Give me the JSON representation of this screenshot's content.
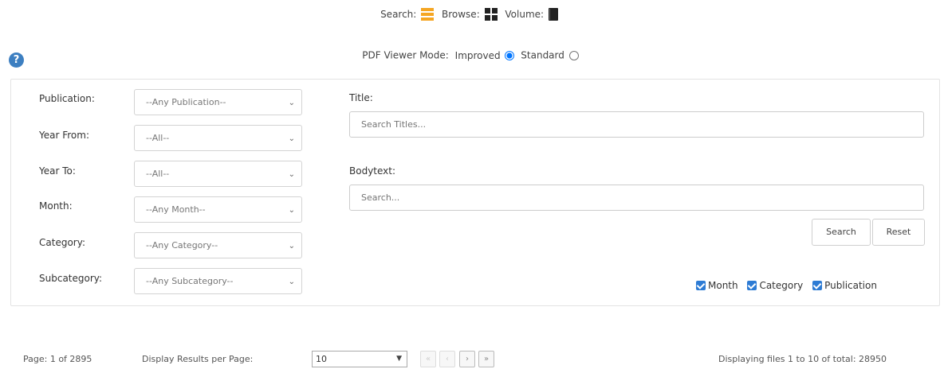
{
  "modebar": {
    "search_label": "Search:",
    "browse_label": "Browse:",
    "volume_label": "Volume:"
  },
  "viewer_mode": {
    "label": "PDF Viewer Mode:",
    "improved_label": "Improved",
    "standard_label": "Standard",
    "selected": "Improved"
  },
  "help_icon": "?",
  "filters": {
    "publication": {
      "label": "Publication:",
      "value": "--Any Publication--"
    },
    "year_from": {
      "label": "Year From:",
      "value": "--All--"
    },
    "year_to": {
      "label": "Year To:",
      "value": "--All--"
    },
    "month": {
      "label": "Month:",
      "value": "--Any Month--"
    },
    "category": {
      "label": "Category:",
      "value": "--Any Category--"
    },
    "subcategory": {
      "label": "Subcategory:",
      "value": "--Any Subcategory--"
    }
  },
  "title_field": {
    "label": "Title:",
    "placeholder": "Search Titles..."
  },
  "bodytext_field": {
    "label": "Bodytext:",
    "placeholder": "Search..."
  },
  "buttons": {
    "search": "Search",
    "reset": "Reset"
  },
  "group_by": {
    "month": "Month",
    "category": "Category",
    "publication": "Publication"
  },
  "footer": {
    "page_info": "Page: 1 of 2895",
    "per_page_label": "Display Results per Page:",
    "per_page_value": "10",
    "first": "«",
    "prev": "‹",
    "next": "›",
    "last": "»",
    "displaying": "Displaying files 1 to 10 of total: 28950"
  },
  "colors": {
    "accent": "#2d7bd4",
    "search_icon": "#f5a623",
    "help_icon": "#3d7fc1"
  }
}
